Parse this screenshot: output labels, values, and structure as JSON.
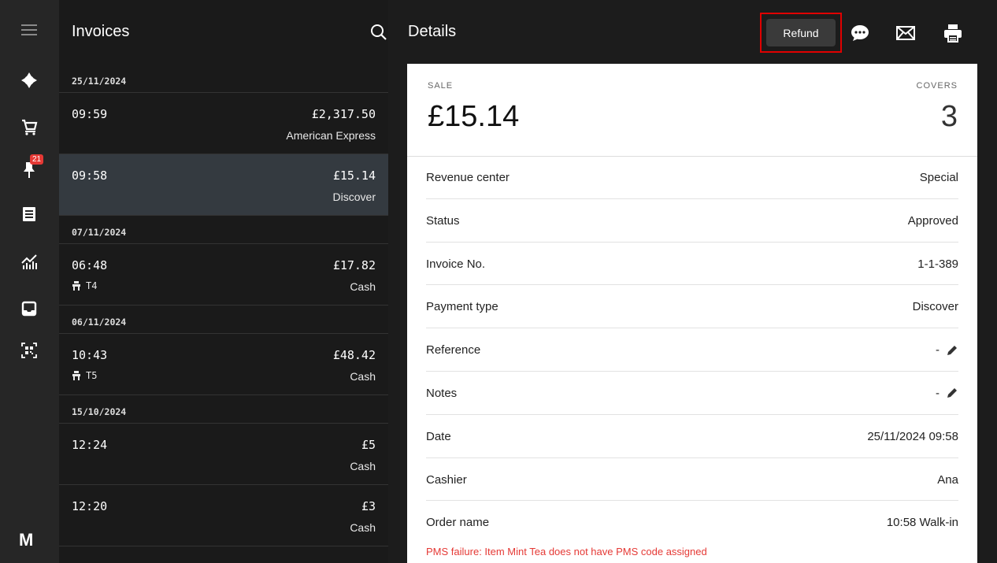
{
  "list": {
    "title": "Invoices",
    "groups": [
      {
        "date": "25/11/2024",
        "items": [
          {
            "time": "09:59",
            "amount": "£2,317.50",
            "payment": "American Express",
            "table": ""
          },
          {
            "time": "09:58",
            "amount": "£15.14",
            "payment": "Discover",
            "table": ""
          }
        ]
      },
      {
        "date": "07/11/2024",
        "items": [
          {
            "time": "06:48",
            "amount": "£17.82",
            "payment": "Cash",
            "table": "T4"
          }
        ]
      },
      {
        "date": "06/11/2024",
        "items": [
          {
            "time": "10:43",
            "amount": "£48.42",
            "payment": "Cash",
            "table": "T5"
          }
        ]
      },
      {
        "date": "15/10/2024",
        "items": [
          {
            "time": "12:24",
            "amount": "£5",
            "payment": "Cash",
            "table": ""
          },
          {
            "time": "12:20",
            "amount": "£3",
            "payment": "Cash",
            "table": ""
          }
        ]
      }
    ]
  },
  "rail": {
    "notification_count": "21",
    "brand": "M"
  },
  "details": {
    "title": "Details",
    "refund_label": "Refund",
    "sale_label": "SALE",
    "sale_value": "£15.14",
    "covers_label": "COVERS",
    "covers_value": "3",
    "fields": [
      {
        "label": "Revenue center",
        "value": "Special"
      },
      {
        "label": "Status",
        "value": "Approved"
      },
      {
        "label": "Invoice No.",
        "value": "1-1-389"
      },
      {
        "label": "Payment type",
        "value": "Discover"
      },
      {
        "label": "Reference",
        "value": "-"
      },
      {
        "label": "Notes",
        "value": "-"
      },
      {
        "label": "Date",
        "value": "25/11/2024 09:58"
      },
      {
        "label": "Cashier",
        "value": "Ana"
      },
      {
        "label": "Order name",
        "value": "10:58 Walk-in"
      }
    ],
    "error": "PMS failure: Item Mint Tea does not have PMS code assigned"
  }
}
